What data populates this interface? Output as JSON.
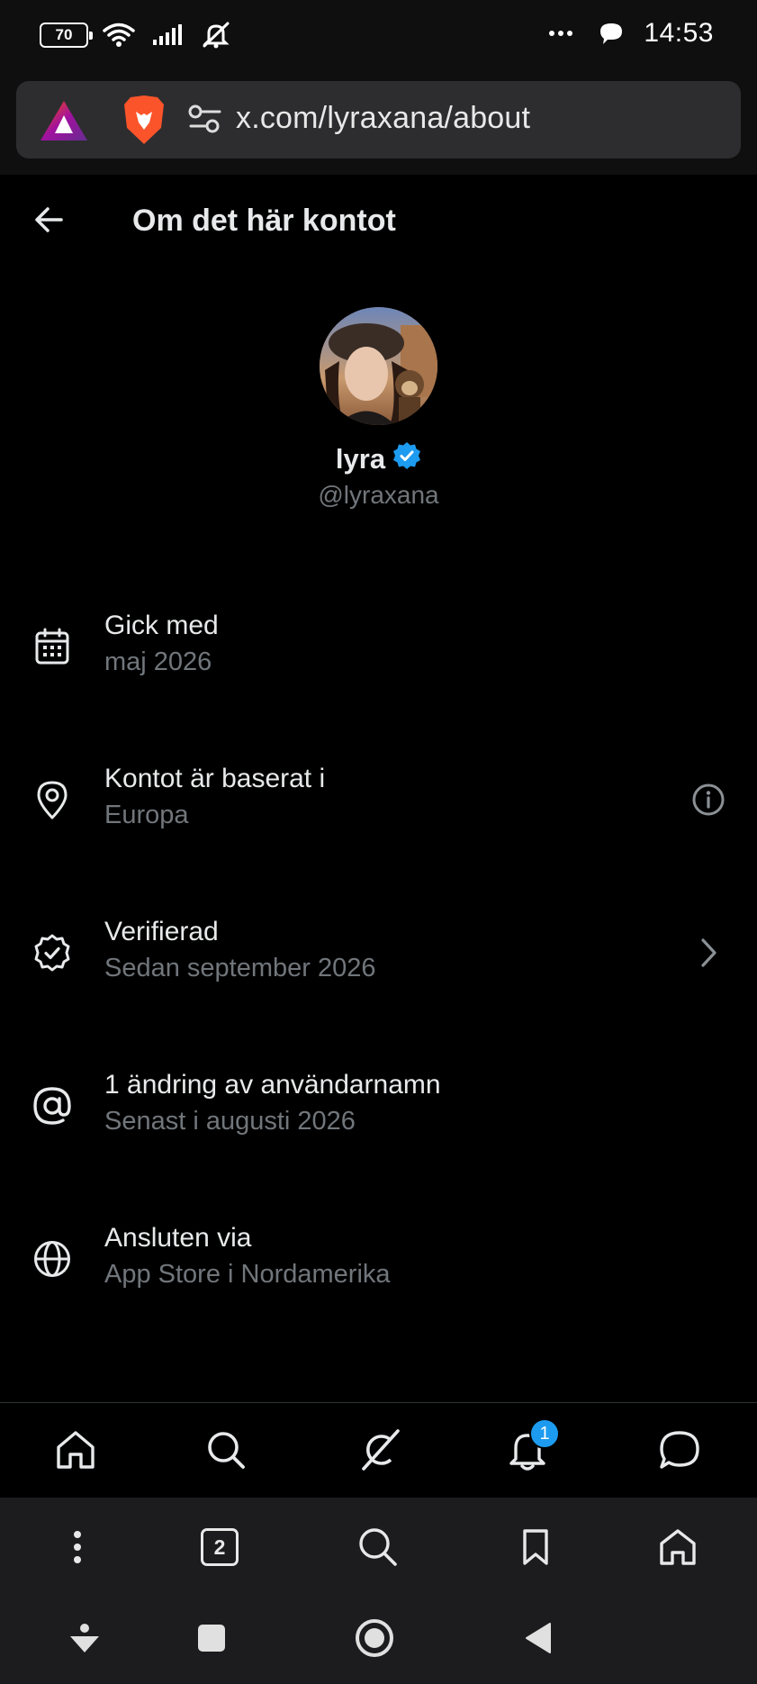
{
  "status_bar": {
    "battery": "70",
    "time": "14:53",
    "icons": [
      "wifi-icon",
      "signal-icon",
      "mute-icon",
      "more-dots-icon",
      "chat-notification-icon"
    ]
  },
  "browser": {
    "url": "x.com/lyraxana/about",
    "tab_count": "2"
  },
  "header": {
    "title": "Om det här kontot"
  },
  "profile": {
    "display_name": "lyra",
    "handle": "@lyraxana",
    "verified": true
  },
  "rows": [
    {
      "icon": "calendar-icon",
      "title": "Gick med",
      "subtitle": "maj 2026",
      "trailing": ""
    },
    {
      "icon": "location-pin-icon",
      "title": "Kontot är baserat i",
      "subtitle": "Europa",
      "trailing": "info-icon"
    },
    {
      "icon": "verified-badge-icon",
      "title": "Verifierad",
      "subtitle": "Sedan september 2026",
      "trailing": "chevron-right-icon"
    },
    {
      "icon": "at-sign-icon",
      "title": "1 ändring av användarnamn",
      "subtitle": "Senast i augusti 2026",
      "trailing": ""
    },
    {
      "icon": "globe-icon",
      "title": "Ansluten via",
      "subtitle": "App Store i Nordamerika",
      "trailing": ""
    }
  ],
  "x_nav": {
    "items": [
      "home-icon",
      "search-icon",
      "grok-icon",
      "notifications-icon",
      "messages-icon"
    ],
    "notifications_badge": "1"
  },
  "colors": {
    "accent": "#1d9bf0",
    "background": "#000000",
    "secondary_text": "#71767b",
    "primary_text": "#e7e9ea"
  }
}
